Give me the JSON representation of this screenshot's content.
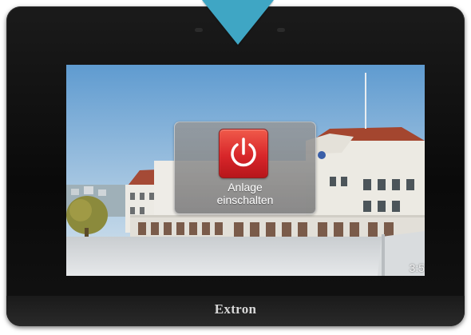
{
  "device": {
    "brand": "Extron",
    "frame_color": "#111111",
    "pointer_color": "#3fa6c4"
  },
  "screen": {
    "background": "building-photo",
    "clock_text": "3:5"
  },
  "power_panel": {
    "icon": "power-icon",
    "button_color": "#d8262a",
    "label_line1": "Anlage",
    "label_line2": "einschalten"
  }
}
